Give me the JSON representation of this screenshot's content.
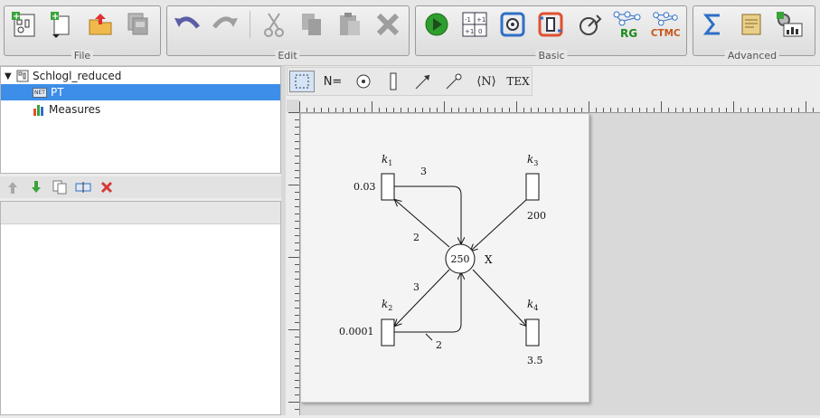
{
  "toolbar": {
    "groups": [
      {
        "label": "File"
      },
      {
        "label": "Edit"
      },
      {
        "label": "Basic"
      },
      {
        "label": "Advanced"
      }
    ],
    "icons": {
      "file": [
        "new-model-icon",
        "new-document-icon",
        "open-folder-icon",
        "save-copies-icon"
      ],
      "edit": [
        "undo-icon",
        "redo-icon",
        "cut-icon",
        "copy-icon",
        "paste-icon",
        "delete-icon"
      ],
      "basic": [
        "play-icon",
        "matrix-icon",
        "flow-icon",
        "inhibit-icon",
        "measure-icon",
        "rg-icon",
        "ctmc-icon"
      ],
      "advanced": [
        "sum-icon",
        "scroll-icon",
        "settings-chart-icon"
      ]
    },
    "rg_label": "RG",
    "ctmc_label": "CTMC"
  },
  "tree": {
    "root": "Schlogl_reduced",
    "items": [
      {
        "label": "PT",
        "badge": "NET"
      },
      {
        "label": "Measures"
      }
    ]
  },
  "mini_toolbar": {
    "icons": [
      "move-up-icon",
      "move-down-icon",
      "duplicate-icon",
      "rename-icon",
      "delete-icon"
    ]
  },
  "editor_tools": {
    "n_label": "N=",
    "n_angle_label": "⟨N⟩",
    "tex_label": "TEX"
  },
  "net": {
    "place": {
      "tokens": "250",
      "name": "X"
    },
    "transitions": [
      {
        "name": "k",
        "index": "1",
        "rate": "0.03"
      },
      {
        "name": "k",
        "index": "2",
        "rate": "0.0001"
      },
      {
        "name": "k",
        "index": "3",
        "rate": "200"
      },
      {
        "name": "k",
        "index": "4",
        "rate": "3.5"
      }
    ],
    "arc_weights": {
      "k1_out": "3",
      "k1_in": "2",
      "k2_out": "3",
      "k2_in": "2"
    }
  },
  "colors": {
    "selection": "#3d8ee8",
    "play": "#2e9e2e",
    "delete": "#d33a3a",
    "undo": "#5b5ea6"
  }
}
